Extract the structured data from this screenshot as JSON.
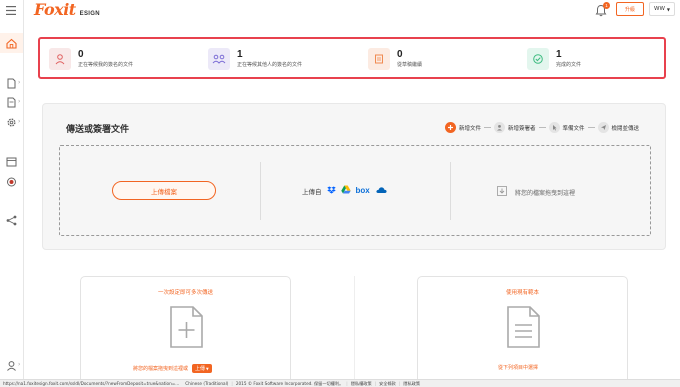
{
  "header": {
    "brand": "Foxit",
    "product": "ESIGN",
    "notification_count": "1",
    "upgrade_label": "升級",
    "user_initials": "WW"
  },
  "stats": [
    {
      "count": "0",
      "label": "正在等候我的簽名的文件",
      "icon": "user-icon",
      "color": "#f8e8e8"
    },
    {
      "count": "1",
      "label": "正在等候其他人的簽名的文件",
      "icon": "group-icon",
      "color": "#ece9f8"
    },
    {
      "count": "0",
      "label": "從草稿繼續",
      "icon": "draft-icon",
      "color": "#fcebe2"
    },
    {
      "count": "1",
      "label": "完成的文件",
      "icon": "check-icon",
      "color": "#e3f6ee"
    }
  ],
  "upload": {
    "title": "傳送或簽署文件",
    "steps": [
      "新增文件",
      "新增簽署者",
      "準備文件",
      "檢閱並傳送"
    ],
    "upload_button": "上傳檔案",
    "upload_from": "上傳自",
    "cloud_services": [
      "dropbox-icon",
      "google-drive-icon",
      "box-icon",
      "onedrive-icon"
    ],
    "box_label": "box",
    "drag_text": "將您的檔案拖曳到這裡"
  },
  "cards": {
    "left": {
      "title": "一次設定即可多次傳送",
      "text": "將您的檔案拖曳到這裡或",
      "button": "上傳"
    },
    "right": {
      "title": "使用現有範本",
      "text": "從下列項目中選擇"
    }
  },
  "statusbar": {
    "url": "https://na1.foxitesign.foxit.com/ssldl/Documents/?newFromDeposit=true&nation=...",
    "language": "Chinese (Traditional)",
    "copyright": "2015 © Foxit Software Incorporated. 保留一切權利。",
    "links": [
      "隱私權政策",
      "安全條款",
      "隱私政策"
    ]
  },
  "colors": {
    "accent": "#f26522",
    "highlight": "#e8414d"
  }
}
